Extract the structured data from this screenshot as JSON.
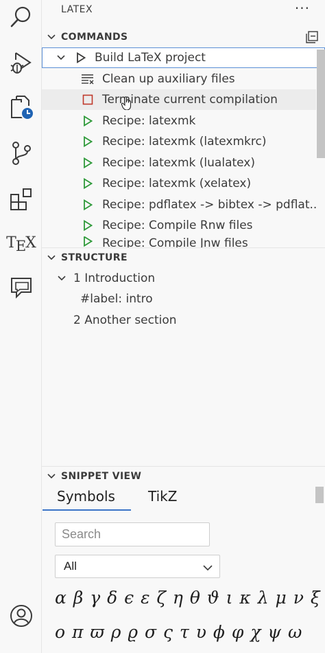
{
  "activity_bar": {
    "items": [
      {
        "name": "search-icon"
      },
      {
        "name": "run-debug-icon"
      },
      {
        "name": "explorer-timeline-icon"
      },
      {
        "name": "source-control-icon"
      },
      {
        "name": "extensions-icon"
      },
      {
        "name": "tex-icon",
        "text_T": "T",
        "text_E": "E",
        "text_X": "X"
      },
      {
        "name": "comments-icon"
      },
      {
        "name": "account-icon"
      }
    ]
  },
  "panel": {
    "title": "LATEX",
    "more": "···"
  },
  "commands": {
    "header": "COMMANDS",
    "items": [
      {
        "label": "Build LaTeX project",
        "icon": "play-outline-icon"
      },
      {
        "label": "Clean up auxiliary files",
        "icon": "clear-all-icon"
      },
      {
        "label": "Terminate current compilation",
        "icon": "stop-icon"
      },
      {
        "label": "Recipe: latexmk",
        "icon": "play-green-icon"
      },
      {
        "label": "Recipe: latexmk (latexmkrc)",
        "icon": "play-green-icon"
      },
      {
        "label": "Recipe: latexmk (lualatex)",
        "icon": "play-green-icon"
      },
      {
        "label": "Recipe: latexmk (xelatex)",
        "icon": "play-green-icon"
      },
      {
        "label": "Recipe: pdflatex -> bibtex -> pdflat...",
        "icon": "play-green-icon"
      },
      {
        "label": "Recipe: Compile Rnw files",
        "icon": "play-green-icon"
      },
      {
        "label": "Recipe: Compile Jnw files",
        "icon": "play-green-icon"
      }
    ]
  },
  "structure": {
    "header": "STRUCTURE",
    "items": [
      {
        "label": "1 Introduction"
      },
      {
        "label": "#label: intro"
      },
      {
        "label": "2 Another section"
      }
    ]
  },
  "snippet_view": {
    "header": "SNIPPET VIEW",
    "tabs": [
      {
        "label": "Symbols"
      },
      {
        "label": "TikZ"
      }
    ],
    "search_placeholder": "Search",
    "filter_value": "All",
    "symbols_row1": "α β γ δ ϵ ε ζ η θ ϑ ι κ λ μ ν ξ",
    "symbols_row2": "ο π ϖ ρ ϱ σ ς τ υ ϕ φ χ ψ ω"
  },
  "colors": {
    "accent": "#3b74c7",
    "play_green": "#2f9a3a",
    "stop_red": "#c0392b"
  }
}
